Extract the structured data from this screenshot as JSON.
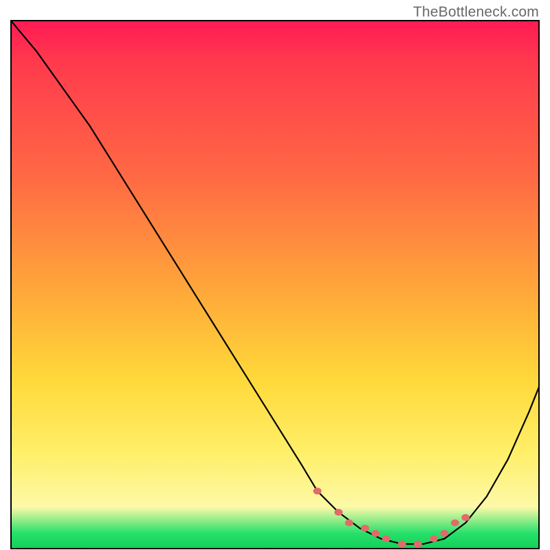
{
  "watermark": "TheBottleneck.com",
  "colors": {
    "curve_stroke": "#000000",
    "dot_fill": "#e26a6a",
    "border": "#000000"
  },
  "chart_data": {
    "type": "line",
    "title": "",
    "xlabel": "",
    "ylabel": "",
    "xlim": [
      0,
      100
    ],
    "ylim": [
      0,
      100
    ],
    "grid": false,
    "series": [
      {
        "name": "bottleneck-curve",
        "x": [
          0,
          5,
          10,
          15,
          20,
          25,
          30,
          35,
          40,
          45,
          50,
          55,
          58,
          62,
          66,
          70,
          74,
          78,
          82,
          86,
          90,
          94,
          98,
          100
        ],
        "y": [
          100,
          94,
          87,
          80,
          72,
          64,
          56,
          48,
          40,
          32,
          24,
          16,
          11,
          7,
          4,
          2,
          1,
          1,
          2,
          5,
          10,
          17,
          26,
          31
        ]
      }
    ],
    "highlight_dots": {
      "name": "flat-region-dots",
      "x": [
        58,
        62,
        64,
        67,
        69,
        71,
        74,
        77,
        80,
        82,
        84,
        86
      ],
      "y": [
        11,
        7,
        5,
        4,
        3,
        2,
        1,
        1,
        2,
        3,
        5,
        6
      ]
    }
  }
}
